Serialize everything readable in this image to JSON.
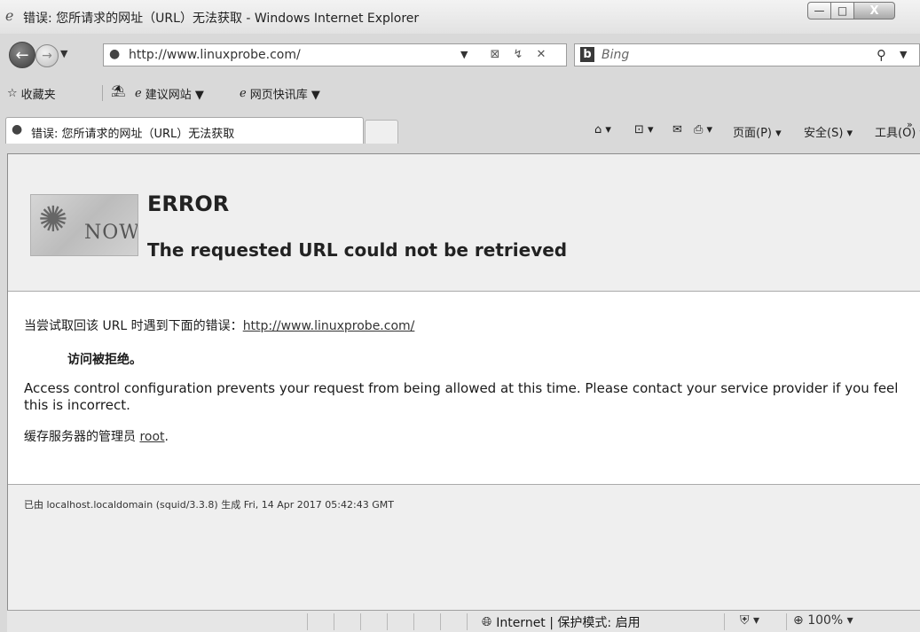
{
  "window": {
    "title": "错误: 您所请求的网址（URL）无法获取 - Windows Internet Explorer",
    "minimize": "—",
    "maximize": "□",
    "close": "X"
  },
  "nav": {
    "url": "http://www.linuxprobe.com/",
    "search_placeholder": "Bing"
  },
  "favorites": {
    "favorites_label": "收藏夹",
    "items": [
      {
        "label": "建议网站 ▼"
      },
      {
        "label": "网页快讯库 ▼"
      }
    ]
  },
  "tab": {
    "title": "错误: 您所请求的网址（URL）无法获取"
  },
  "commands": {
    "page": "页面(P) ▾",
    "safety": "安全(S) ▾",
    "tools": "工具(O) ▾",
    "more": "»"
  },
  "page": {
    "logo_text": "NOW",
    "error_title": "ERROR",
    "error_subtitle": "The requested URL could not be retrieved",
    "line1_prefix": "当尝试取回该 URL 时遇到下面的错误：",
    "line1_link": "http://www.linuxprobe.com/",
    "denied": "访问被拒绝。",
    "policy": "Access control configuration prevents your request from being allowed at this time. Please contact your service provider if you feel this is incorrect.",
    "admin_prefix": "缓存服务器的管理员 ",
    "admin_link": "root",
    "admin_suffix": ".",
    "footer": "已由 localhost.localdomain (squid/3.3.8) 生成 Fri, 14 Apr 2017 05:42:43 GMT"
  },
  "status": {
    "zone": "Internet | 保护模式: 启用",
    "zoom": "100%"
  }
}
